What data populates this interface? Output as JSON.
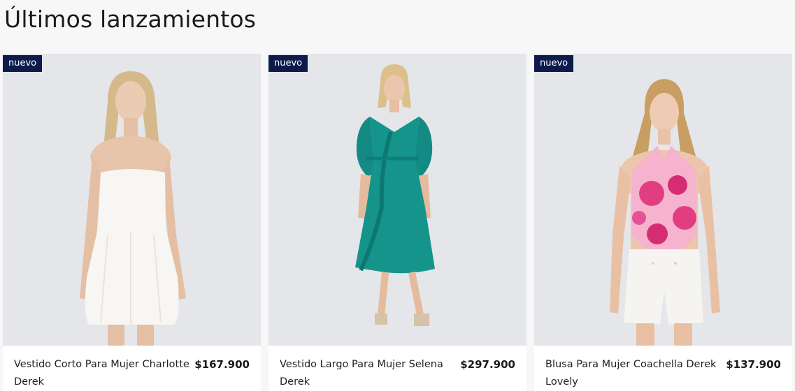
{
  "section": {
    "title": "Últimos lanzamientos"
  },
  "products": [
    {
      "badge": "nuevo",
      "name": "Vestido Corto Para Mujer Charlotte Derek",
      "price": "$167.900",
      "image_desc": "model-white-strapless-dress"
    },
    {
      "badge": "nuevo",
      "name": "Vestido Largo Para Mujer Selena Derek",
      "price": "$297.900",
      "image_desc": "model-teal-wrap-dress"
    },
    {
      "badge": "nuevo",
      "name": "Blusa Para Mujer Coachella Derek Lovely",
      "price": "$137.900",
      "image_desc": "model-pink-floral-halter-top"
    }
  ],
  "colors": {
    "badge_bg": "#0d1b4c",
    "image_bg": "#e4e6e9",
    "page_bg": "#f7f7f8"
  }
}
